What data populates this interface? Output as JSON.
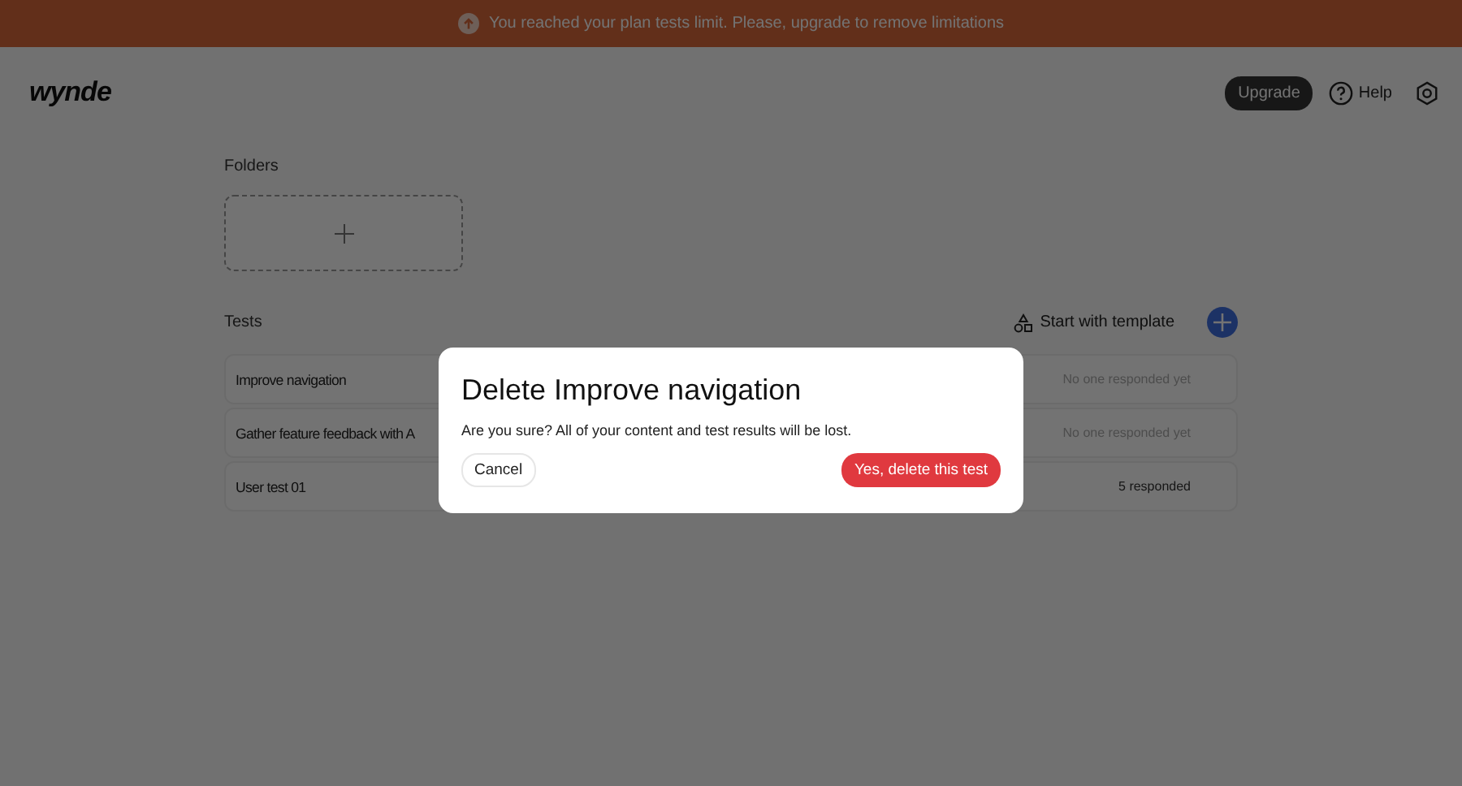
{
  "banner": {
    "message": "You reached your plan tests limit. Please, upgrade to remove limitations"
  },
  "header": {
    "logo": "wynde",
    "upgrade": "Upgrade",
    "help": "Help"
  },
  "folders": {
    "title": "Folders"
  },
  "tests": {
    "title": "Tests",
    "template_button": "Start with template",
    "rows": [
      {
        "name": "Improve navigation",
        "status": "No one responded yet",
        "muted": true
      },
      {
        "name": "Gather feature feedback with A",
        "status": "No one responded yet",
        "muted": true
      },
      {
        "name": "User test 01",
        "status": "5 responded",
        "muted": false
      }
    ]
  },
  "dialog": {
    "title": "Delete Improve navigation",
    "message": "Are you sure? All of your content and test results will be lost.",
    "cancel": "Cancel",
    "confirm": "Yes, delete this test"
  }
}
